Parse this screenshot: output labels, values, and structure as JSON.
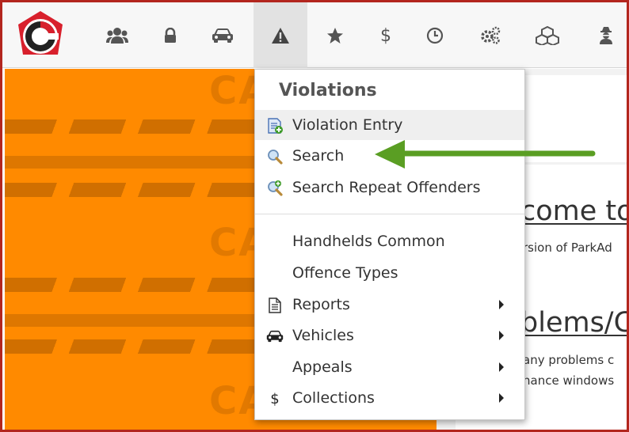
{
  "nav": {
    "items": [
      {
        "icon": "users-icon"
      },
      {
        "icon": "lock-icon"
      },
      {
        "icon": "car-icon"
      },
      {
        "icon": "warning-icon",
        "active": true
      },
      {
        "icon": "star-icon"
      },
      {
        "icon": "dollar-icon"
      },
      {
        "icon": "clock-icon"
      },
      {
        "icon": "gears-icon"
      },
      {
        "icon": "cubes-icon"
      },
      {
        "icon": "user-secret-icon"
      }
    ]
  },
  "background": {
    "watermark_text": "CA"
  },
  "content": {
    "heading1": "come to",
    "subtext1": "rsion of ParkAd",
    "heading2": "blems/C",
    "subtext2_line1": "any problems c",
    "subtext2_line2": "nance windows"
  },
  "menu": {
    "title": "Violations",
    "items": [
      {
        "label": "Violation Entry",
        "icon": "document-add-icon",
        "highlighted": true
      },
      {
        "label": "Search",
        "icon": "magnifier-icon"
      },
      {
        "label": "Search Repeat Offenders",
        "icon": "magnifier-add-icon"
      },
      {
        "label": "Handhelds Common"
      },
      {
        "label": "Offence Types"
      },
      {
        "label": "Reports",
        "icon": "file-text-icon",
        "submenu": true
      },
      {
        "label": "Vehicles",
        "icon": "car-icon",
        "submenu": true
      },
      {
        "label": "Appeals",
        "submenu": true
      },
      {
        "label": "Collections",
        "icon": "dollar-icon",
        "submenu": true
      }
    ]
  },
  "colors": {
    "accent_border": "#b3261e",
    "background_orange": "#ff8a00",
    "annotation_arrow": "#5a9e23"
  }
}
